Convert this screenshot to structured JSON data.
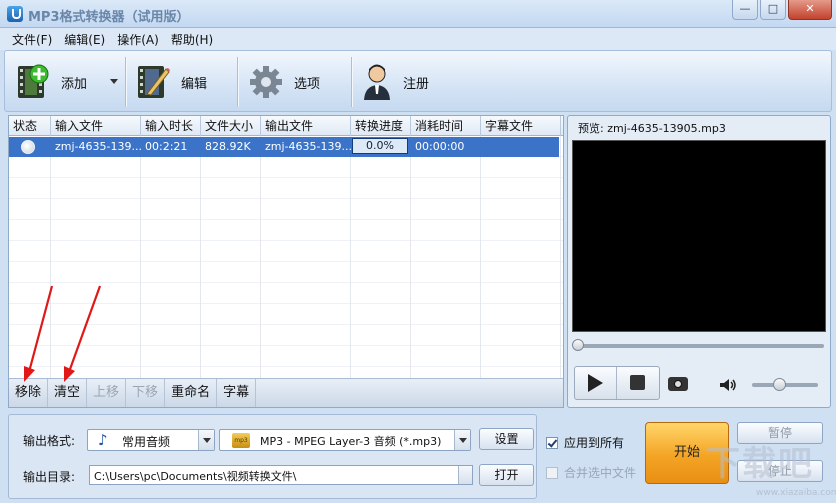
{
  "window": {
    "title": "MP3格式转换器（试用版）",
    "minimize": "—",
    "maximize": "□",
    "close": "✕"
  },
  "menu": [
    {
      "label": "文件(F)"
    },
    {
      "label": "编辑(E)"
    },
    {
      "label": "操作(A)"
    },
    {
      "label": "帮助(H)"
    }
  ],
  "toolbar": {
    "add_label": "添加",
    "edit_label": "编辑",
    "options_label": "选项",
    "register_label": "注册"
  },
  "grid": {
    "columns": [
      "状态",
      "输入文件",
      "输入时长",
      "文件大小",
      "输出文件",
      "转换进度",
      "消耗时间",
      "字幕文件"
    ],
    "rows": [
      {
        "input_file": "zmj-4635-139...",
        "duration": "00:2:21",
        "size": "828.92K",
        "output_file": "zmj-4635-139...",
        "progress": "0.0%",
        "elapsed": "00:00:00",
        "subtitle": ""
      }
    ]
  },
  "list_actions": {
    "remove": "移除",
    "clear": "清空",
    "move_up": "上移",
    "move_down": "下移",
    "rename": "重命名",
    "subtitle": "字幕"
  },
  "preview": {
    "title": "预览: zmj-4635-13905.mp3",
    "seek_fraction": 0.0,
    "volume_fraction": 0.4
  },
  "output": {
    "format_label": "输出格式:",
    "format_category": "常用音频",
    "format_value": "MP3 - MPEG Layer-3 音频 (*.mp3)",
    "settings_button": "设置",
    "dir_label": "输出目录:",
    "dir_value": "C:\\Users\\pc\\Documents\\视频转换文件\\",
    "open_button": "打开"
  },
  "options": {
    "apply_all": {
      "label": "应用到所有",
      "checked": true
    },
    "merge_selected": {
      "label": "合并选中文件",
      "checked": false
    }
  },
  "actions": {
    "start": "开始",
    "pause": "暂停",
    "stop": "停止"
  },
  "watermark": {
    "text": "下载吧",
    "sub": "www.xiazaiba.com"
  },
  "colors": {
    "accent": "#3b73c8",
    "start_button": "#f4a424",
    "annotation_arrow": "#e01818"
  }
}
